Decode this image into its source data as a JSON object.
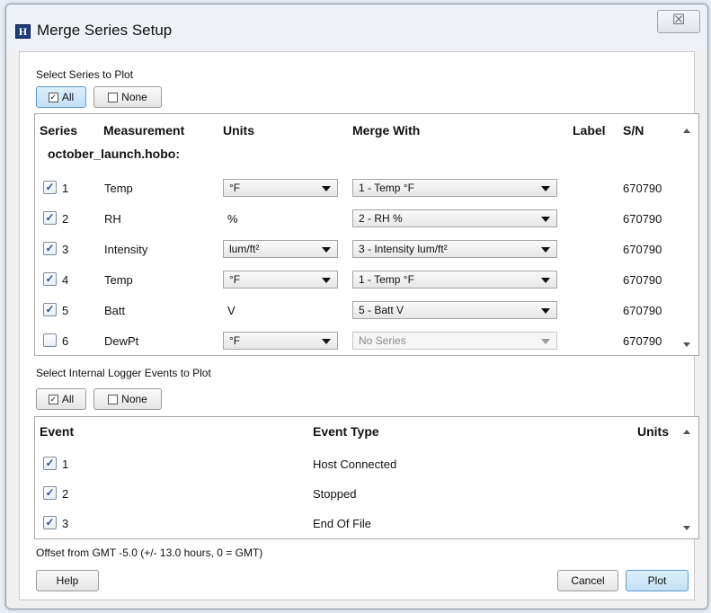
{
  "window": {
    "title": "Merge Series Setup",
    "app_icon_letter": "H",
    "close_glyph": "☒"
  },
  "series_section": {
    "label": "Select Series to Plot",
    "all_label": "All",
    "none_label": "None",
    "headers": {
      "series": "Series",
      "measurement": "Measurement",
      "units": "Units",
      "merge_with": "Merge With",
      "label": "Label",
      "sn": "S/N"
    },
    "file_name": "october_launch.hobo:",
    "rows": [
      {
        "checked": true,
        "num": "1",
        "measurement": "Temp",
        "units": "°F",
        "units_dropdown": true,
        "merge": "1 - Temp °F",
        "merge_disabled": false,
        "sn": "670790"
      },
      {
        "checked": true,
        "num": "2",
        "measurement": "RH",
        "units": "%",
        "units_dropdown": false,
        "merge": "2 - RH %",
        "merge_disabled": false,
        "sn": "670790"
      },
      {
        "checked": true,
        "num": "3",
        "measurement": "Intensity",
        "units": "lum/ft²",
        "units_dropdown": true,
        "merge": "3 - Intensity lum/ft²",
        "merge_disabled": false,
        "sn": "670790"
      },
      {
        "checked": true,
        "num": "4",
        "measurement": "Temp",
        "units": "°F",
        "units_dropdown": true,
        "merge": "1 - Temp °F",
        "merge_disabled": false,
        "sn": "670790"
      },
      {
        "checked": true,
        "num": "5",
        "measurement": "Batt",
        "units": "V",
        "units_dropdown": false,
        "merge": "5 - Batt V",
        "merge_disabled": false,
        "sn": "670790"
      },
      {
        "checked": false,
        "num": "6",
        "measurement": "DewPt",
        "units": "°F",
        "units_dropdown": true,
        "merge": "No Series",
        "merge_disabled": true,
        "sn": "670790"
      }
    ]
  },
  "events_section": {
    "label": "Select Internal Logger Events to Plot",
    "all_label": "All",
    "none_label": "None",
    "headers": {
      "event": "Event",
      "event_type": "Event Type",
      "units": "Units"
    },
    "rows": [
      {
        "checked": true,
        "num": "1",
        "type": "Host Connected"
      },
      {
        "checked": true,
        "num": "2",
        "type": "Stopped"
      },
      {
        "checked": true,
        "num": "3",
        "type": "End Of File"
      }
    ]
  },
  "footer": {
    "offset_text": "Offset from GMT -5.0  (+/- 13.0 hours, 0 = GMT)",
    "help_label": "Help",
    "cancel_label": "Cancel",
    "plot_label": "Plot"
  },
  "check_glyph": "✓",
  "colors": {
    "accent": "#5b9bd5",
    "checkbox_mark": "#2a4e9a",
    "app_icon_bg": "#1e3d7a"
  }
}
